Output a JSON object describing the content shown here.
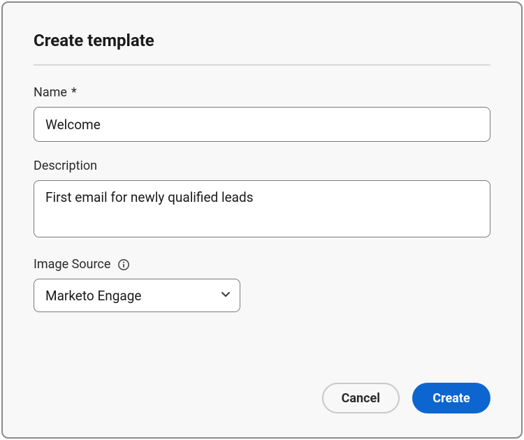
{
  "dialog": {
    "title": "Create template"
  },
  "fields": {
    "name": {
      "label": "Name",
      "required_marker": "*",
      "value": "Welcome"
    },
    "description": {
      "label": "Description",
      "value": "First email for newly qualified leads"
    },
    "image_source": {
      "label": "Image Source",
      "selected": "Marketo Engage"
    }
  },
  "buttons": {
    "cancel": "Cancel",
    "create": "Create"
  },
  "colors": {
    "primary": "#0d66d0",
    "border": "#7a7a7a",
    "dialog_border": "#8a8a8a",
    "background": "#f8f8f8"
  }
}
